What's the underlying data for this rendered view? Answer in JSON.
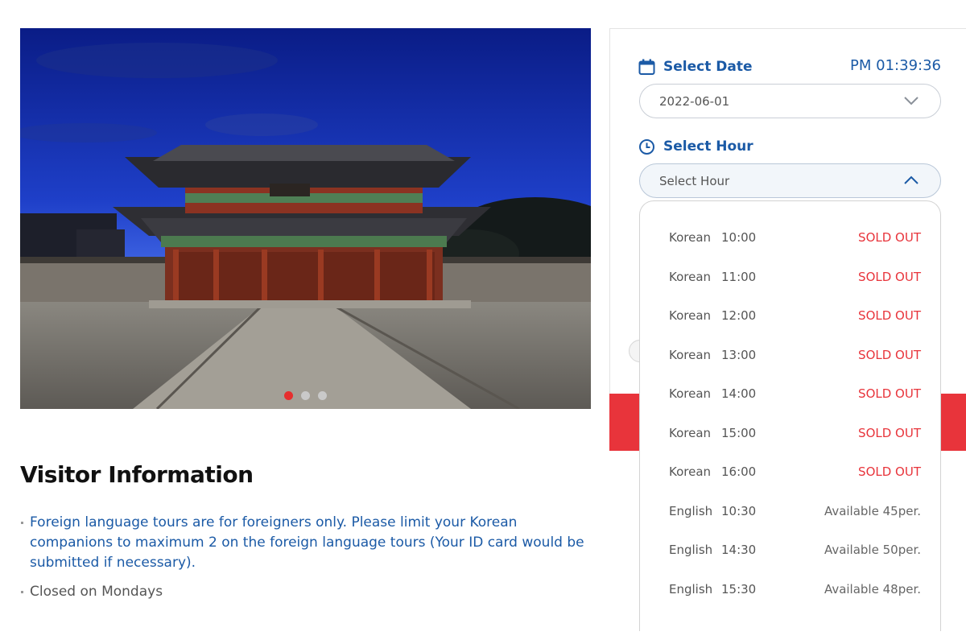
{
  "hero": {
    "image_alt": "Palace gate at dusk",
    "slides": 3,
    "active_slide": 1
  },
  "visitor_info": {
    "title": "Visitor Information",
    "items": [
      "Foreign language tours are for foreigners only. Please limit your Korean companions to maximum 2 on the foreign language tours (Your ID card would be submitted if necessary).",
      "Closed on Mondays"
    ]
  },
  "booking": {
    "date_label": "Select Date",
    "clock": "PM 01:39:36",
    "date_value": "2022-06-01",
    "hour_label": "Select Hour",
    "hour_placeholder": "Select Hour",
    "hour_options": [
      {
        "lang": "Korean",
        "time": "10:00",
        "status": "SOLD OUT"
      },
      {
        "lang": "Korean",
        "time": "11:00",
        "status": "SOLD OUT"
      },
      {
        "lang": "Korean",
        "time": "12:00",
        "status": "SOLD OUT"
      },
      {
        "lang": "Korean",
        "time": "13:00",
        "status": "SOLD OUT"
      },
      {
        "lang": "Korean",
        "time": "14:00",
        "status": "SOLD OUT"
      },
      {
        "lang": "Korean",
        "time": "15:00",
        "status": "SOLD OUT"
      },
      {
        "lang": "Korean",
        "time": "16:00",
        "status": "SOLD OUT"
      },
      {
        "lang": "English",
        "time": "10:30",
        "status": "Available 45per."
      },
      {
        "lang": "English",
        "time": "14:30",
        "status": "Available 50per."
      },
      {
        "lang": "English",
        "time": "15:30",
        "status": "Available 48per."
      }
    ]
  },
  "icons": {
    "calendar": "calendar-icon",
    "clock": "clock-icon",
    "chevron_down": "chevron-down-icon",
    "chevron_up": "chevron-up-icon"
  },
  "colors": {
    "accent_blue": "#1b5aa6",
    "sold_out_red": "#e8343b",
    "active_dot": "#e62e2e"
  }
}
